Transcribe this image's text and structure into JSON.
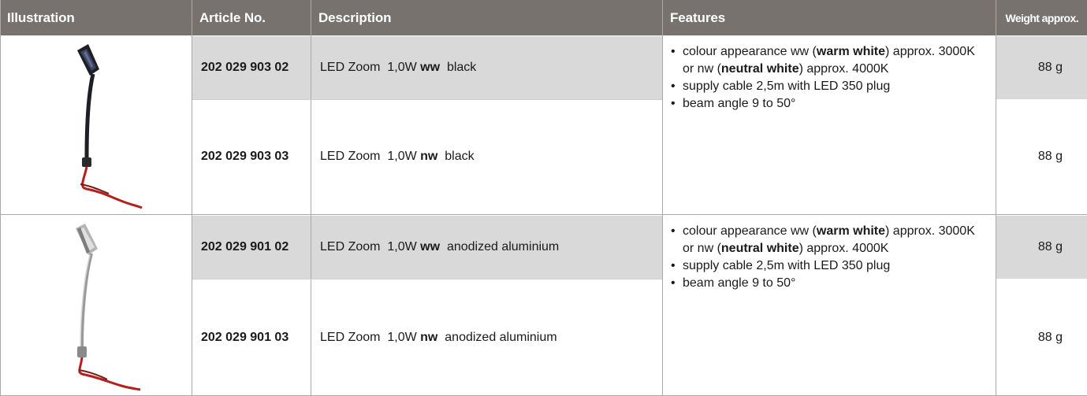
{
  "headers": {
    "illustration": "Illustration",
    "article_no": "Article No.",
    "description": "Description",
    "features": "Features",
    "weight": "Weight approx."
  },
  "groups": [
    {
      "finish": "black",
      "features": [
        {
          "pre": "colour appearance ww (",
          "bold": "warm white",
          "post": ") approx. 3000K"
        },
        {
          "pre": "or nw (",
          "bold": "neutral white",
          "post": ") approx. 4000K"
        },
        {
          "pre": "supply cable 2,5m with LED 350 plug",
          "bold": "",
          "post": ""
        },
        {
          "pre": "beam angle 9 to 50°",
          "bold": "",
          "post": ""
        }
      ],
      "rows": [
        {
          "article": "202 029 903 02",
          "desc_pre": "LED Zoom  1,0W ",
          "desc_bold": "ww",
          "desc_post": "  black",
          "weight": "88 g"
        },
        {
          "article": "202 029 903 03",
          "desc_pre": "LED Zoom  1,0W ",
          "desc_bold": "nw",
          "desc_post": "  black",
          "weight": "88 g"
        }
      ]
    },
    {
      "finish": "anodized aluminium",
      "features": [
        {
          "pre": "colour appearance ww (",
          "bold": "warm white",
          "post": ") approx. 3000K"
        },
        {
          "pre": "or nw (",
          "bold": "neutral white",
          "post": ") approx. 4000K"
        },
        {
          "pre": "supply cable 2,5m with LED 350 plug",
          "bold": "",
          "post": ""
        },
        {
          "pre": "beam angle 9 to 50°",
          "bold": "",
          "post": ""
        }
      ],
      "rows": [
        {
          "article": "202 029 901 02",
          "desc_pre": "LED Zoom  1,0W ",
          "desc_bold": "ww",
          "desc_post": "  anodized aluminium",
          "weight": "88 g"
        },
        {
          "article": "202 029 901 03",
          "desc_pre": "LED Zoom  1,0W ",
          "desc_bold": "nw",
          "desc_post": "  anodized aluminium",
          "weight": "88 g"
        }
      ]
    }
  ],
  "colors": {
    "header_bg": "#77726d",
    "row_shade": "#d9d9d9",
    "lamp_black": "#1e1f24",
    "lamp_aluminium": "#9a9a9a",
    "cable": "#b3201c"
  }
}
